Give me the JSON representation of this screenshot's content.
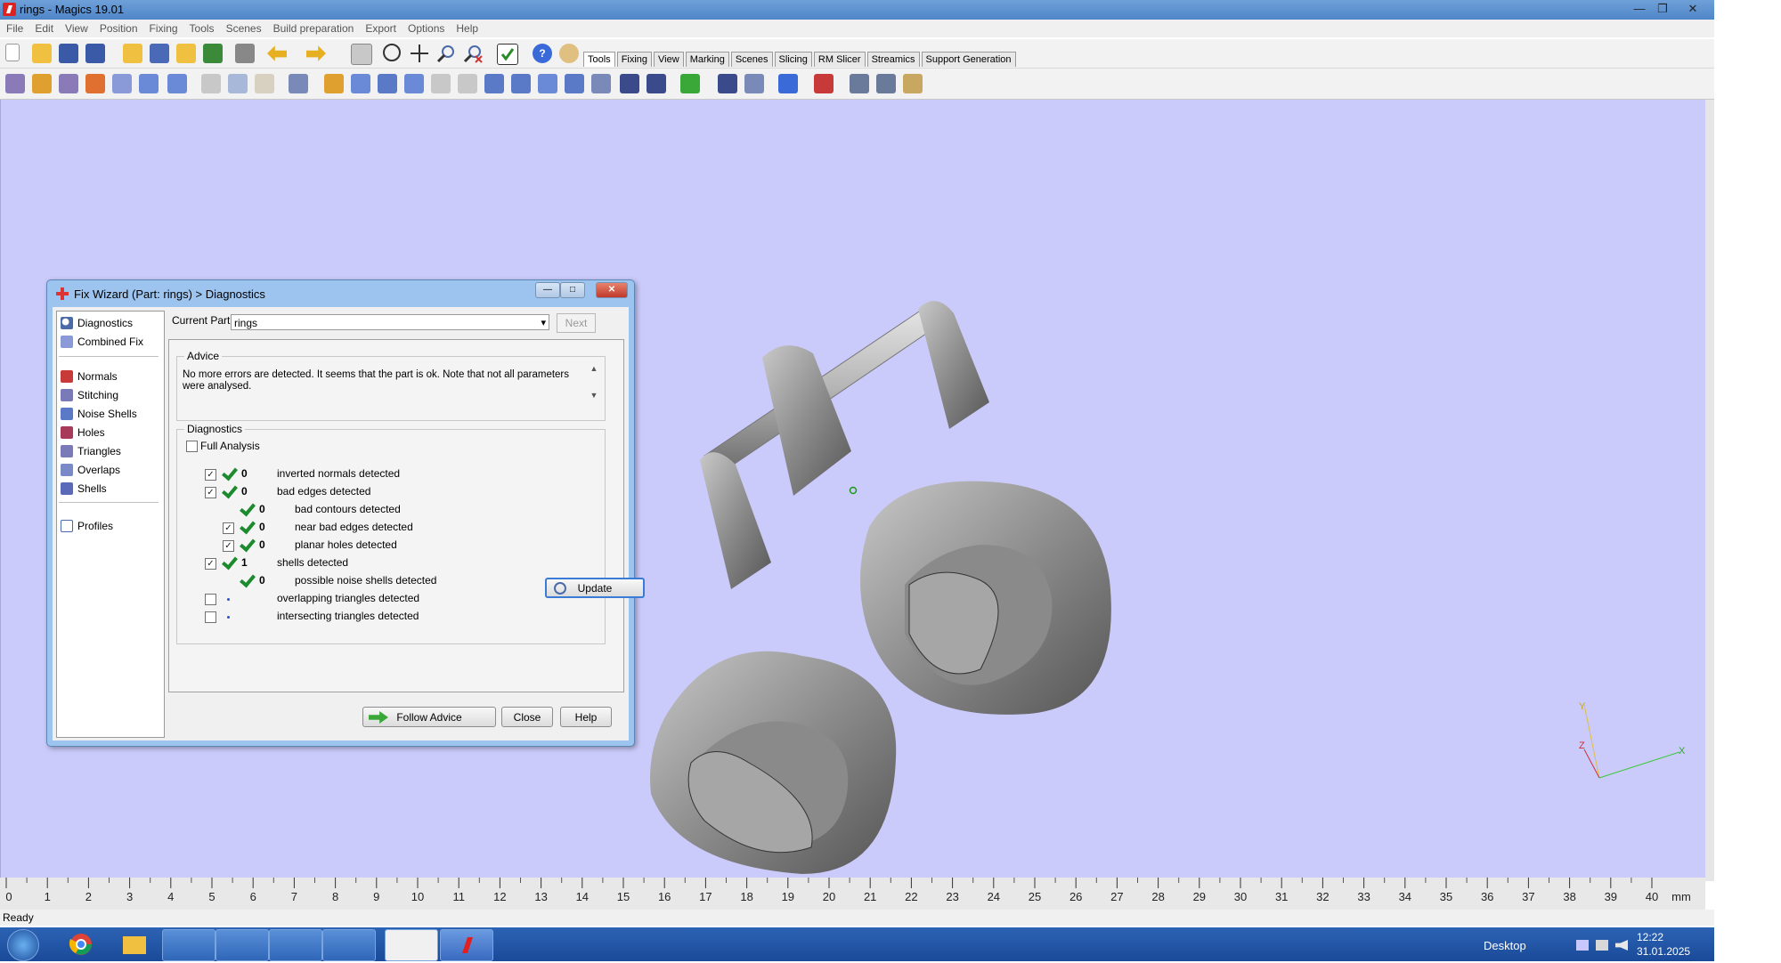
{
  "window": {
    "title": "rings - Magics 19.01"
  },
  "menu": [
    "File",
    "Edit",
    "View",
    "Position",
    "Fixing",
    "Tools",
    "Scenes",
    "Build preparation",
    "Export",
    "Options",
    "Help"
  ],
  "toolbar_tabs": [
    "Tools",
    "Fixing",
    "View",
    "Marking",
    "Scenes",
    "Slicing",
    "RM Slicer",
    "Streamics",
    "Support Generation"
  ],
  "dialog": {
    "title": "Fix Wizard (Part: rings) > Diagnostics",
    "nav_top": [
      "Diagnostics",
      "Combined Fix"
    ],
    "nav_mid": [
      "Normals",
      "Stitching",
      "Noise Shells",
      "Holes",
      "Triangles",
      "Overlaps",
      "Shells"
    ],
    "nav_bottom": [
      "Profiles"
    ],
    "current_part_label": "Current Part:",
    "current_part_value": "rings",
    "next_label": "Next",
    "advice_title": "Advice",
    "advice_text": "No more errors are detected. It seems that the part is ok. Note that not all parameters were analysed.",
    "diagnostics_title": "Diagnostics",
    "full_analysis_label": "Full Analysis",
    "rows": [
      {
        "count": "0",
        "label": "inverted normals detected",
        "indent": 0,
        "checkbox": true,
        "status": "ok"
      },
      {
        "count": "0",
        "label": "bad edges detected",
        "indent": 0,
        "checkbox": true,
        "status": "ok"
      },
      {
        "count": "0",
        "label": "bad contours detected",
        "indent": 1,
        "checkbox": false,
        "status": "ok"
      },
      {
        "count": "0",
        "label": "near bad edges detected",
        "indent": 1,
        "checkbox": true,
        "status": "ok"
      },
      {
        "count": "0",
        "label": "planar holes detected",
        "indent": 1,
        "checkbox": true,
        "status": "ok"
      },
      {
        "count": "1",
        "label": "shells detected",
        "indent": 0,
        "checkbox": true,
        "status": "ok"
      },
      {
        "count": "0",
        "label": "possible noise shells detected",
        "indent": 1,
        "checkbox": false,
        "status": "ok"
      },
      {
        "count": "",
        "label": "overlapping triangles detected",
        "indent": 0,
        "checkbox": true,
        "status": "none"
      },
      {
        "count": "",
        "label": "intersecting triangles detected",
        "indent": 0,
        "checkbox": true,
        "status": "none"
      }
    ],
    "update_label": "Update",
    "follow_advice_label": "Follow Advice",
    "close_label": "Close",
    "help_label": "Help"
  },
  "ruler": {
    "labels": [
      "0",
      "1",
      "2",
      "3",
      "4",
      "5",
      "6",
      "7",
      "8",
      "9",
      "10",
      "11",
      "12",
      "13",
      "14",
      "15",
      "16",
      "17",
      "18",
      "19",
      "20",
      "21",
      "22",
      "23",
      "24",
      "25",
      "26",
      "27",
      "28",
      "29",
      "30",
      "31",
      "32",
      "33",
      "34",
      "35",
      "36",
      "37",
      "38",
      "39",
      "40"
    ],
    "unit": "mm"
  },
  "axis_labels": {
    "x": "X",
    "y": "Y",
    "z": "Z"
  },
  "status": "Ready",
  "taskbar": {
    "desktop_label": "Desktop",
    "time": "12:22",
    "date": "31.01.2025"
  },
  "colors": {
    "viewport_bg": "#cbcbfb",
    "model_gray": "#8a8a8a",
    "check_green": "#1c8a2e",
    "taskbar_blue": "#1a4a99"
  }
}
